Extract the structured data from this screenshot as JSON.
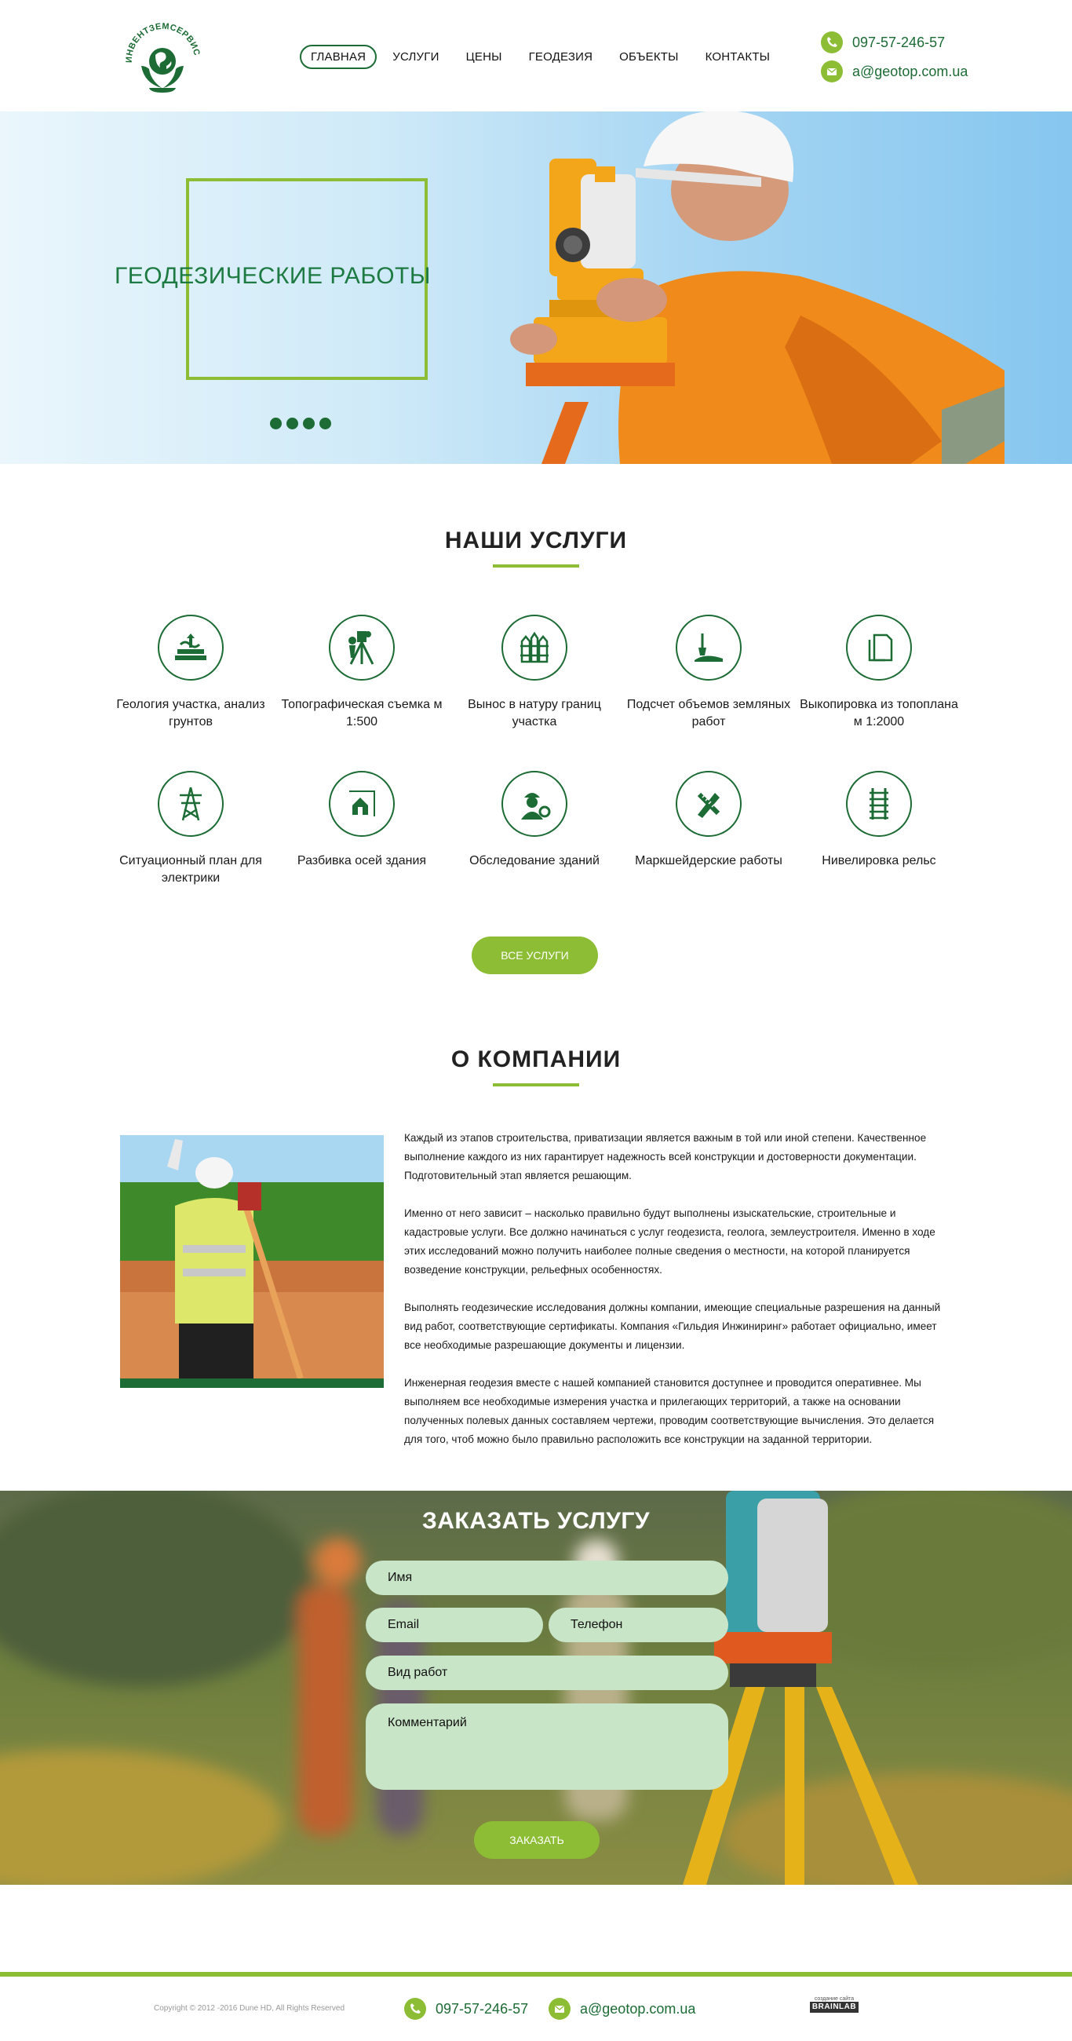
{
  "brand": {
    "logo_text": "ИНВЕНТЗЕМСЕРВИС"
  },
  "nav": [
    {
      "label": "ГЛАВНАЯ",
      "active": true
    },
    {
      "label": "УСЛУГИ"
    },
    {
      "label": "ЦЕНЫ"
    },
    {
      "label": "ГЕОДЕЗИЯ"
    },
    {
      "label": "ОБЪЕКТЫ"
    },
    {
      "label": "КОНТАКТЫ"
    }
  ],
  "contacts": {
    "phone": "097-57-246-57",
    "email": "a@geotop.com.ua"
  },
  "hero": {
    "title": "ГЕОДЕЗИЧЕСКИЕ РАБОТЫ",
    "slides": 4
  },
  "services": {
    "title": "НАШИ УСЛУГИ",
    "items": [
      {
        "label": "Геология участка, анализ грунтов",
        "icon": "geology-icon"
      },
      {
        "label": "Топографическая съемка м 1:500",
        "icon": "theodolite-icon"
      },
      {
        "label": "Вынос в натуру границ участка",
        "icon": "boundary-fence-icon"
      },
      {
        "label": "Подсчет объемов земляных работ",
        "icon": "shovel-icon"
      },
      {
        "label": "Выкопировка из топоплана м 1:2000",
        "icon": "document-copy-icon"
      },
      {
        "label": "Ситуационный план для электрики",
        "icon": "power-tower-icon"
      },
      {
        "label": "Разбивка осей здания",
        "icon": "house-axes-icon"
      },
      {
        "label": "Обследование зданий",
        "icon": "engineer-icon"
      },
      {
        "label": "Маркшейдерские работы",
        "icon": "pencil-ruler-icon"
      },
      {
        "label": "Нивелировка рельс",
        "icon": "rails-icon"
      }
    ],
    "all_button": "ВСЕ УСЛУГИ"
  },
  "about": {
    "title": "О КОМПАНИИ",
    "paragraphs": [
      "Каждый из этапов строительства, приватизации является важным в той или иной степени. Качественное выполнение каждого из них гарантирует надежность всей конструкции и достоверности документации. Подготовительный этап является решающим.",
      "Именно от него зависит – насколько правильно будут выполнены изыскательские, строительные и кадастровые услуги. Все должно начинаться с услуг геодезиста, геолога, землеустроителя. Именно в ходе этих исследований можно получить наиболее полные сведения о местности, на которой планируется возведение конструкции, рельефных особенностях.",
      "Выполнять геодезические исследования должны компании, имеющие специальные разрешения на данный вид работ, соответствующие сертификаты. Компания «Гильдия Инжиниринг» работает официально, имеет все необходимые разрешающие документы и лицензии.",
      "Инженерная геодезия вместе с нашей компанией становится доступнее и проводится оперативнее. Мы выполняем все необходимые измерения участка и прилегающих территорий, а также на основании полученных полевых данных составляем чертежи, проводим соответствующие вычисления. Это делается для того, чтоб можно было правильно расположить все конструкции на заданной территории."
    ]
  },
  "order": {
    "title": "ЗАКАЗАТЬ УСЛУГУ",
    "name_placeholder": "Имя",
    "email_placeholder": "Email",
    "phone_placeholder": "Телефон",
    "work_placeholder": "Вид работ",
    "comment_placeholder": "Комментарий",
    "submit": "ЗАКАЗАТЬ"
  },
  "footer": {
    "copyright": "Copyright © 2012 -2016 Dune HD, All Rights Reserved",
    "phone": "097-57-246-57",
    "email": "a@geotop.com.ua",
    "credit_top": "создание сайта",
    "credit_brand": "BRAINLAB"
  },
  "colors": {
    "dark_green": "#1d6b35",
    "accent_green": "#8cbd34",
    "field_green": "#c9e5c7"
  }
}
